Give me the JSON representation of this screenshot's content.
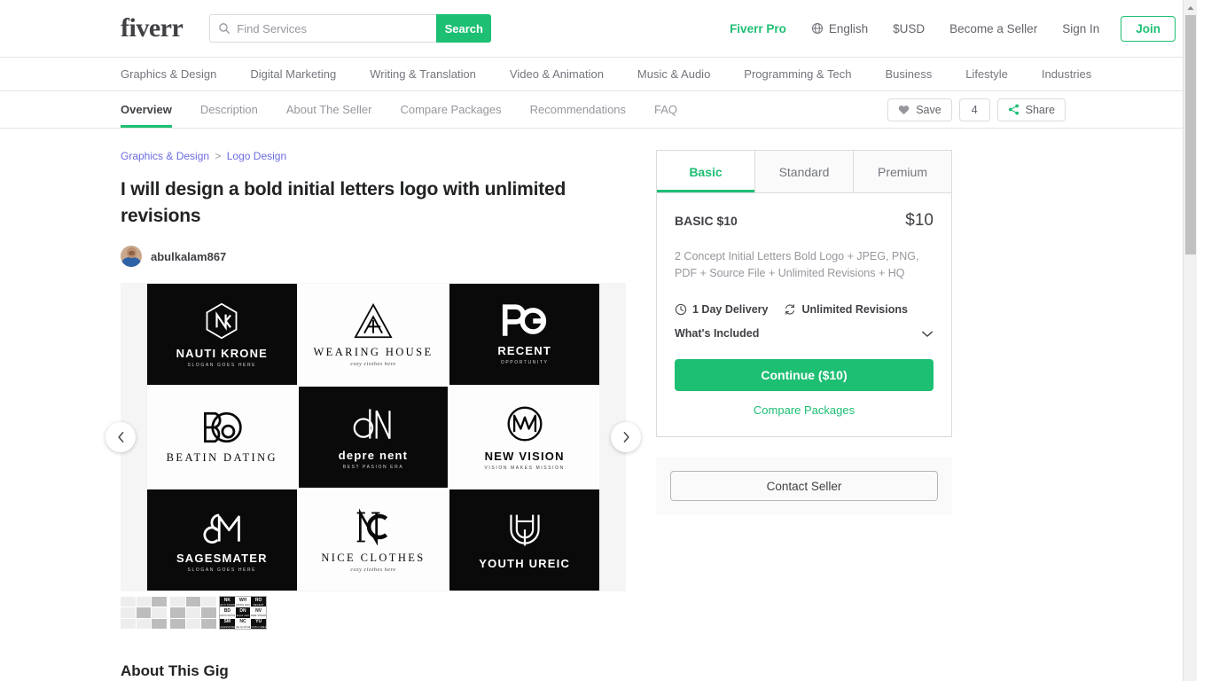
{
  "header": {
    "logo": "fiverr",
    "search": {
      "placeholder": "Find Services",
      "value": "",
      "button": "Search",
      "icon": "search-icon"
    },
    "nav": {
      "pro": "Fiverr Pro",
      "language": "English",
      "language_icon": "globe-icon",
      "currency": "$USD",
      "become_seller": "Become a Seller",
      "sign_in": "Sign In",
      "join": "Join"
    }
  },
  "categories": [
    "Graphics & Design",
    "Digital Marketing",
    "Writing & Translation",
    "Video & Animation",
    "Music & Audio",
    "Programming & Tech",
    "Business",
    "Lifestyle",
    "Industries"
  ],
  "subnav": {
    "tabs": [
      {
        "label": "Overview",
        "active": true
      },
      {
        "label": "Description",
        "active": false
      },
      {
        "label": "About The Seller",
        "active": false
      },
      {
        "label": "Compare Packages",
        "active": false
      },
      {
        "label": "Recommendations",
        "active": false
      },
      {
        "label": "FAQ",
        "active": false
      }
    ],
    "save_label": "Save",
    "save_icon": "heart-icon",
    "save_count": "4",
    "share_label": "Share",
    "share_icon": "share-icon"
  },
  "gig": {
    "breadcrumb": {
      "parent": "Graphics & Design",
      "separator": ">",
      "child": "Logo Design"
    },
    "title": "I will design a bold initial letters logo with unlimited revisions",
    "seller": "abulkalam867",
    "about_heading": "About This Gig"
  },
  "gallery": {
    "prev_icon": "chevron-left-icon",
    "next_icon": "chevron-right-icon",
    "logos": [
      {
        "monogram": "NK",
        "brand": "NAUTI KRONE",
        "slogan": "SLOGAN GOES HERE",
        "theme": "dark",
        "style": "sans"
      },
      {
        "monogram": "WH",
        "brand": "WEARING HOUSE",
        "slogan": "cozy clothes here",
        "theme": "light",
        "style": "serif"
      },
      {
        "monogram": "RO",
        "brand": "RECENT",
        "slogan": "OPPORTUNITY",
        "theme": "dark",
        "style": "sans"
      },
      {
        "monogram": "BD",
        "brand": "BEATIN DATING",
        "slogan": "",
        "theme": "light",
        "style": "serif"
      },
      {
        "monogram": "DN",
        "brand": "depre nent",
        "slogan": "BEST PASION ERA",
        "theme": "dark",
        "style": "sans"
      },
      {
        "monogram": "NV",
        "brand": "NEW VISION",
        "slogan": "VISION MAKES MISSION",
        "theme": "light",
        "style": "sans"
      },
      {
        "monogram": "SM",
        "brand": "SAGESMATER",
        "slogan": "SLOGAN GOES HERE",
        "theme": "dark",
        "style": "sans"
      },
      {
        "monogram": "NC",
        "brand": "NICE CLOTHES",
        "slogan": "cozy clothes here",
        "theme": "light",
        "style": "serif"
      },
      {
        "monogram": "YU",
        "brand": "YOUTH UREIC",
        "slogan": "",
        "theme": "dark",
        "style": "sans"
      }
    ],
    "thumbnails": [
      {
        "name": "thumbnail-1",
        "active": false
      },
      {
        "name": "thumbnail-2",
        "active": false
      },
      {
        "name": "thumbnail-3",
        "active": true
      }
    ]
  },
  "package": {
    "tabs": [
      {
        "label": "Basic",
        "active": true
      },
      {
        "label": "Standard",
        "active": false
      },
      {
        "label": "Premium",
        "active": false
      }
    ],
    "name": "BASIC $10",
    "price": "$10",
    "description": "2 Concept Initial Letters Bold Logo + JPEG, PNG, PDF + Source File + Unlimited Revisions + HQ",
    "delivery": "1 Day Delivery",
    "delivery_icon": "clock-icon",
    "revisions": "Unlimited Revisions",
    "revisions_icon": "refresh-icon",
    "whats_included": "What's Included",
    "whats_included_icon": "chevron-down-icon",
    "continue_label": "Continue ($10)",
    "compare_label": "Compare Packages",
    "contact_label": "Contact Seller"
  },
  "colors": {
    "brand_green": "#1dbf73",
    "text_dark": "#404145",
    "text_muted": "#95979d",
    "link_blue": "#6a6be0"
  }
}
